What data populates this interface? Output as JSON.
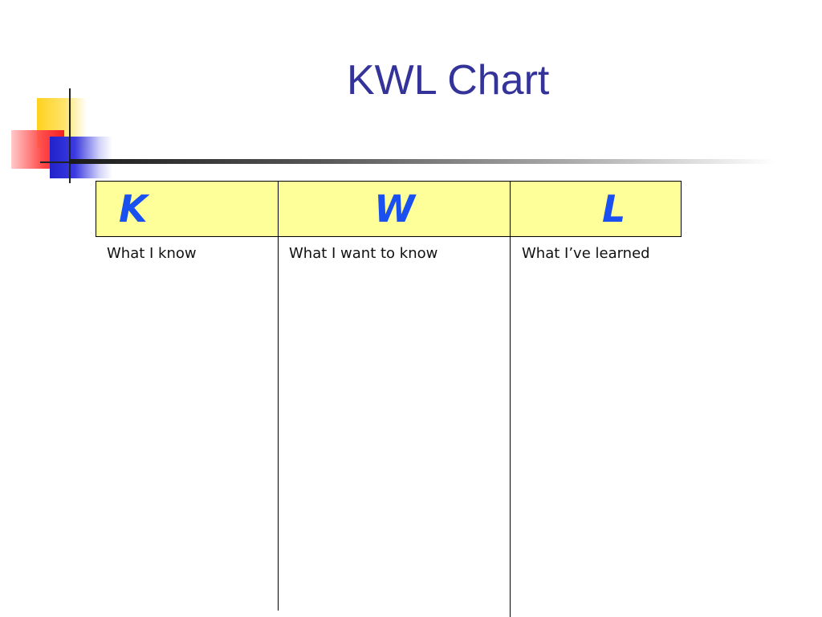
{
  "slide": {
    "title": "KWL Chart",
    "colors": {
      "title": "#333399",
      "header_fill": "#ffff99",
      "header_letters": "#1a4ff0",
      "accent_yellow": "#ffd21f",
      "accent_red": "#ff4848",
      "accent_blue": "#2222cc"
    }
  },
  "chart": {
    "columns": [
      {
        "letter": "K",
        "label": "What I know"
      },
      {
        "letter": "W",
        "label": "What I want to know"
      },
      {
        "letter": "L",
        "label": "What I’ve learned"
      }
    ]
  }
}
